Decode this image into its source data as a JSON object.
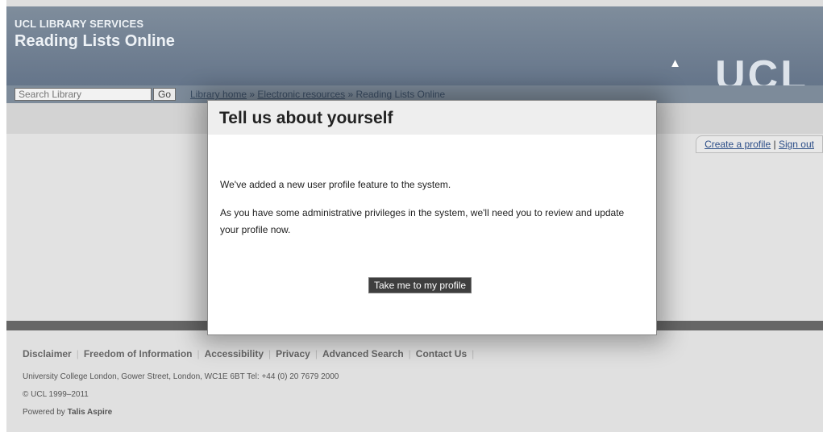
{
  "header": {
    "org": "UCL LIBRARY SERVICES",
    "title": "Reading Lists Online",
    "logo_text": "UCL",
    "logo_icon": "portico-icon"
  },
  "nav": {
    "search_placeholder": "Search Library",
    "go_label": "Go",
    "breadcrumb": [
      {
        "label": "Library home"
      },
      {
        "label": "Electronic resources"
      },
      {
        "label": "Reading Lists Online"
      }
    ],
    "breadcrumb_sep": "»"
  },
  "account": {
    "create_profile": "Create a profile",
    "separator": "|",
    "sign_out": "Sign out"
  },
  "modal": {
    "title": "Tell us about yourself",
    "paragraph1": "We've added a new user profile feature to the system.",
    "paragraph2": "As you have some administrative privileges in the system, we'll need you to review and update your profile now.",
    "button": "Take me to my profile"
  },
  "footer": {
    "links": [
      "Disclaimer",
      "Freedom of Information",
      "Accessibility",
      "Privacy",
      "Advanced Search",
      "Contact Us"
    ],
    "address": "University College London, Gower Street, London, WC1E 6BT Tel: +44 (0) 20 7679 2000",
    "copyright": "© UCL 1999–2011",
    "powered_prefix": "Powered by",
    "powered_name": "Talis Aspire"
  },
  "colors": {
    "header_bg": "#6f7f92",
    "nav_bg": "#7d8b9a",
    "modal_button_bg": "#3e3e3e",
    "link_color": "#2c4e88"
  }
}
